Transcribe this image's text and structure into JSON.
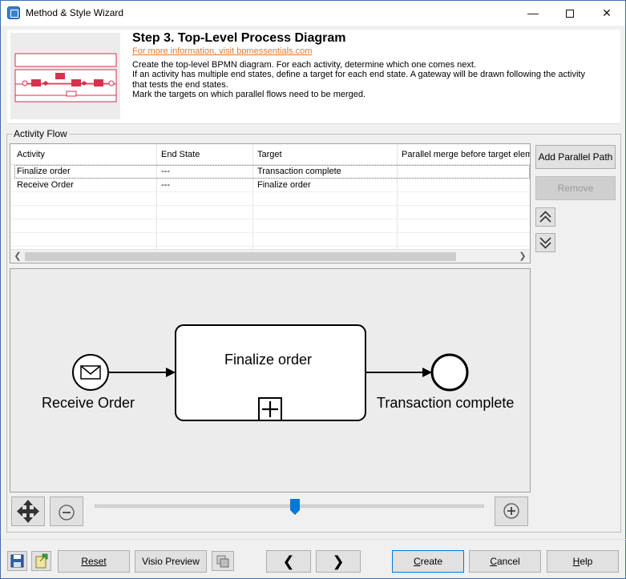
{
  "window": {
    "title": "Method & Style Wizard",
    "minimize": "—",
    "close": "✕"
  },
  "header": {
    "step_title": "Step 3. Top-Level Process Diagram",
    "info_link": "For more information, visit bpmessentials.com",
    "description": "Create the top-level BPMN diagram. For each activity, determine which one comes next.\nIf an activity has multiple end states, define a target for each end state. A gateway will be drawn following the activity\nthat tests the end states.\nMark the targets on which parallel flows need to be merged."
  },
  "activity_flow": {
    "group_label": "Activity Flow",
    "columns": [
      "Activity",
      "End State",
      "Target",
      "Parallel merge before target eleme"
    ],
    "rows": [
      {
        "activity": "Finalize order",
        "end_state": "---",
        "target": "Transaction complete",
        "merge": ""
      },
      {
        "activity": "Receive Order",
        "end_state": "---",
        "target": "Finalize order",
        "merge": ""
      }
    ]
  },
  "side_buttons": {
    "add_parallel_path": "Add Parallel Path",
    "remove": "Remove"
  },
  "diagram": {
    "start_event_label": "Receive Order",
    "task_label": "Finalize order",
    "end_event_label": "Transaction complete"
  },
  "zoom": {
    "level_percent": 51
  },
  "footer": {
    "reset": "Reset",
    "visio_preview": "Visio Preview",
    "create_pre": "",
    "create_key": "C",
    "create_post": "reate",
    "cancel_pre": "",
    "cancel_key": "C",
    "cancel_post": "ancel",
    "help_pre": "",
    "help_key": "H",
    "help_post": "elp",
    "back_glyph": "❮",
    "next_glyph": "❯"
  },
  "colors": {
    "accent_blue": "#0078d7",
    "thumb_red": "#d9304f",
    "link_orange": "#e87722"
  },
  "icons": [
    "app-icon",
    "save-icon",
    "export-icon",
    "copy-icon",
    "pan-icon",
    "zoom-out-icon",
    "zoom-in-icon",
    "move-up-icon",
    "move-down-icon",
    "envelope-icon",
    "subprocess-plus-icon"
  ]
}
